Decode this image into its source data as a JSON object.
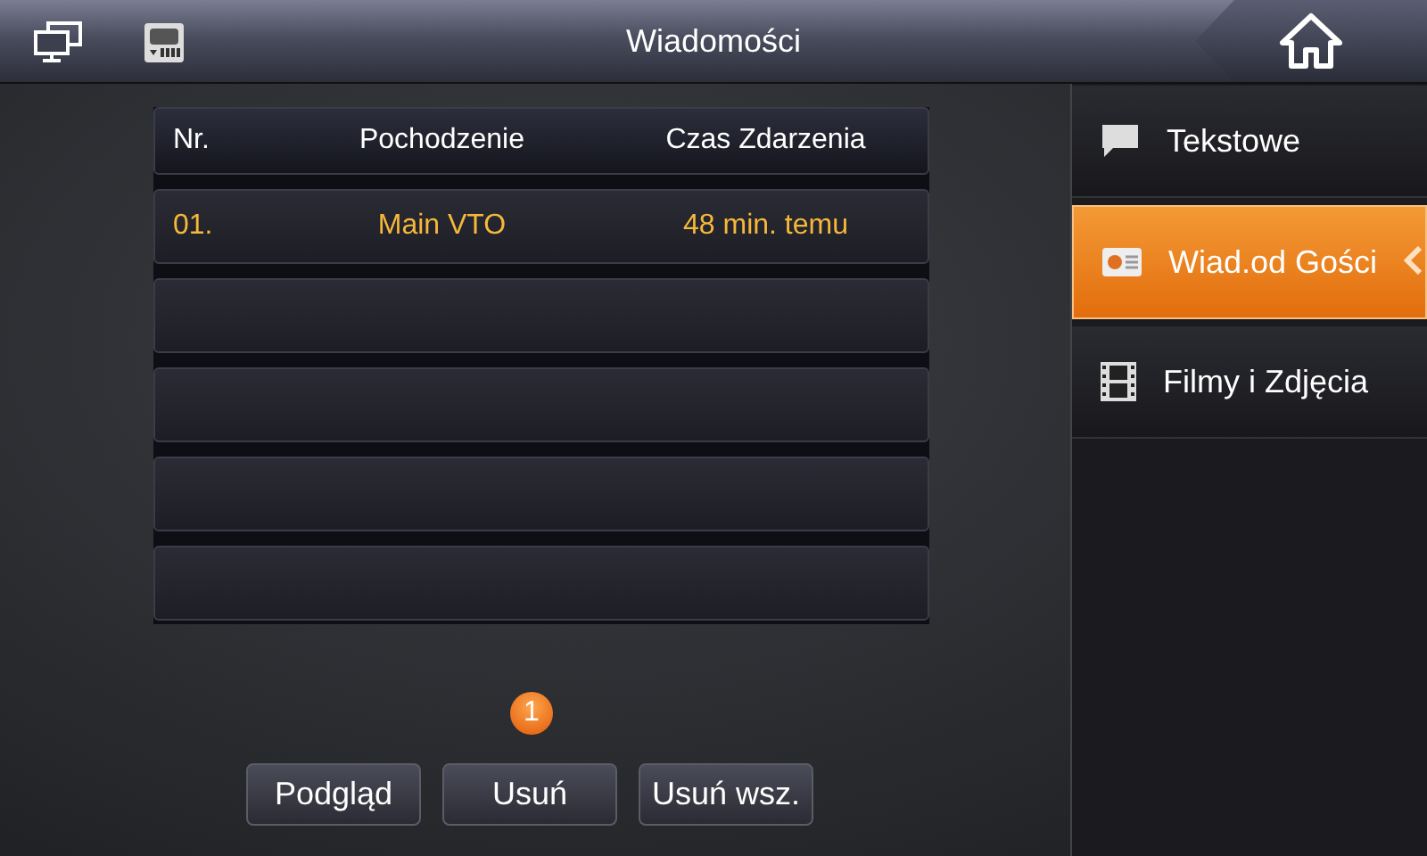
{
  "window": {
    "title": "Wiadomości"
  },
  "table": {
    "columns": [
      "Nr.",
      "Pochodzenie",
      "Czas Zdarzenia"
    ],
    "rows": [
      {
        "cells": [
          "01.",
          "Main VTO",
          "48 min. temu"
        ]
      }
    ]
  },
  "pagination": [
    {
      "label": "1",
      "selected": true
    }
  ],
  "buttons": [
    "Podgląd",
    "Usuń",
    "Usuń wsz."
  ],
  "sidebar": {
    "items": [
      {
        "label": "Tekstowe",
        "selected": false
      },
      {
        "label": "Wiad.od Gości",
        "selected": true
      },
      {
        "label": "Filmy i Zdjęcia",
        "selected": false
      }
    ]
  }
}
